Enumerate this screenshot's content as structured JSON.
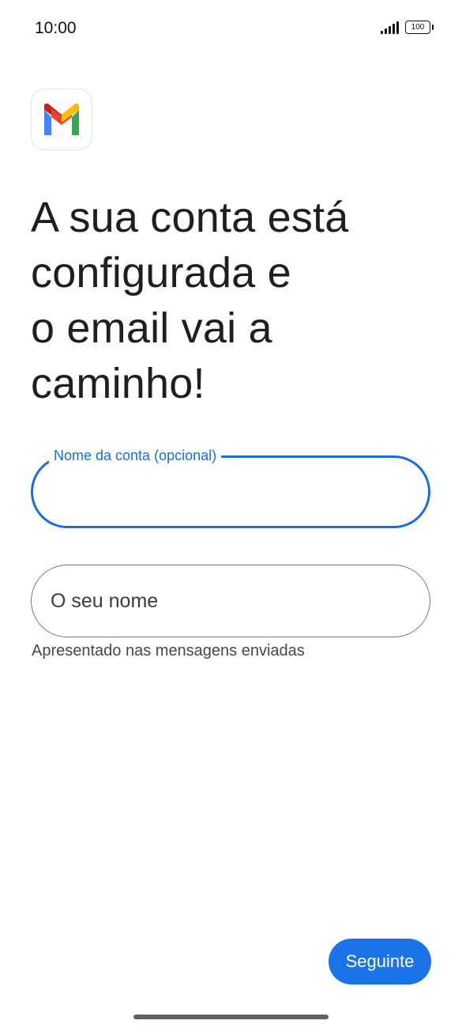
{
  "status_bar": {
    "time": "10:00",
    "battery": "100"
  },
  "app": {
    "logo_icon": "gmail-logo-icon",
    "brand_colors": {
      "blue": "#4285F4",
      "red": "#EA4335",
      "yellow": "#FBBC04",
      "green": "#34A853"
    }
  },
  "headline": {
    "lines": [
      "A sua conta está",
      "configurada e",
      "o email vai a",
      "caminho!"
    ]
  },
  "form": {
    "account_name": {
      "label": "Nome da conta (opcional)",
      "value": ""
    },
    "your_name": {
      "placeholder": "O seu nome",
      "value": "",
      "helper": "Apresentado nas mensagens enviadas"
    }
  },
  "actions": {
    "next_label": "Seguinte",
    "accent_color": "#1a73e8"
  }
}
